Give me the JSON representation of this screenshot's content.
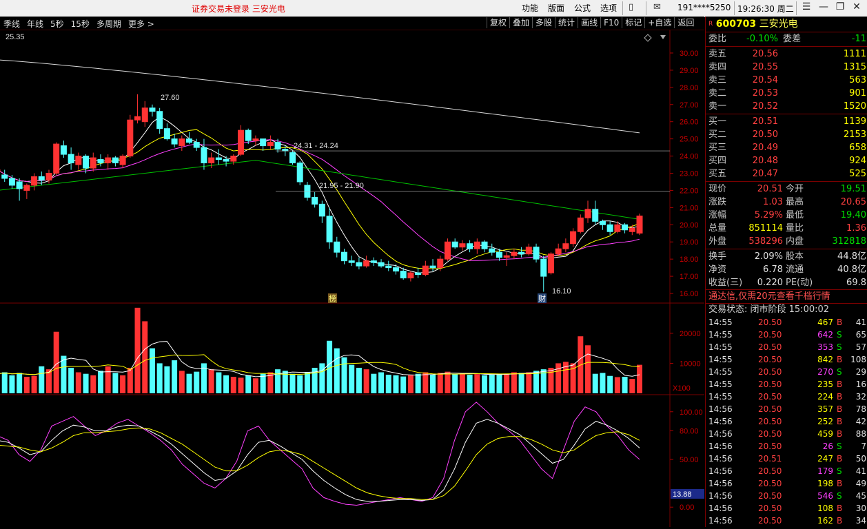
{
  "app": {
    "notice": "证券交易未登录   三安光电",
    "menu": [
      "功能",
      "版面",
      "公式",
      "选项"
    ],
    "user": "191****5250",
    "clock": "19:26:30 周二"
  },
  "tabs_left": [
    "季线",
    "年线",
    "5秒",
    "15秒",
    "多周期",
    "更多 >"
  ],
  "tabs_right": [
    "复权",
    "叠加",
    "多股",
    "统计",
    "画线",
    "F10",
    "标记",
    "+自选",
    "返回"
  ],
  "chart_labels": {
    "ma_readout": "25.35",
    "high_note": "27.60",
    "low_note": "16.10",
    "band_upper": "24.31 - 24.24",
    "band_lower": "21.95 - 21.90",
    "marker_left": "榜",
    "marker_right": "财",
    "vol_unit": "X100",
    "kdj_readout": "13.88"
  },
  "colors": {
    "up": "#ff3333",
    "down": "#54ffff",
    "ma5": "#ffffff",
    "ma10": "#ffff00",
    "ma20": "#ff40ff",
    "ma60": "#00c000"
  },
  "chart_data": [
    {
      "type": "candlestick",
      "title": "",
      "ylim": [
        15.6,
        30.6
      ],
      "yticks": [
        "30.00",
        "29.00",
        "28.00",
        "27.00",
        "26.00",
        "25.00",
        "24.00",
        "23.00",
        "22.00",
        "21.00",
        "20.00",
        "19.00",
        "18.00",
        "17.00",
        "16.00"
      ],
      "candles": [
        [
          23.1,
          23.3,
          22.8,
          23.2
        ],
        [
          22.9,
          23.2,
          22.5,
          22.7
        ],
        [
          22.7,
          22.9,
          22.1,
          22.3
        ],
        [
          22.5,
          22.7,
          21.4,
          22.1
        ],
        [
          22.0,
          22.4,
          21.5,
          22.3
        ],
        [
          22.3,
          23.0,
          22.0,
          22.8
        ],
        [
          22.8,
          23.1,
          22.3,
          22.6
        ],
        [
          22.6,
          23.2,
          22.4,
          23.0
        ],
        [
          23.0,
          24.8,
          22.9,
          24.7
        ],
        [
          24.6,
          24.9,
          23.9,
          24.1
        ],
        [
          24.1,
          24.5,
          23.2,
          23.6
        ],
        [
          23.5,
          24.2,
          23.2,
          24.0
        ],
        [
          24.0,
          24.1,
          23.0,
          23.3
        ],
        [
          23.3,
          24.2,
          23.1,
          23.9
        ],
        [
          23.8,
          24.1,
          23.4,
          23.6
        ],
        [
          23.6,
          24.1,
          23.2,
          23.9
        ],
        [
          23.9,
          24.0,
          23.4,
          23.6
        ],
        [
          23.5,
          24.1,
          23.3,
          24.0
        ],
        [
          24.0,
          26.4,
          23.9,
          26.1
        ],
        [
          26.1,
          27.6,
          25.9,
          26.3
        ],
        [
          26.0,
          27.2,
          25.7,
          26.8
        ],
        [
          26.8,
          27.0,
          26.3,
          26.6
        ],
        [
          26.6,
          26.8,
          25.3,
          25.6
        ],
        [
          25.6,
          25.9,
          24.9,
          25.0
        ],
        [
          25.0,
          25.3,
          24.5,
          24.7
        ],
        [
          24.6,
          25.2,
          24.3,
          25.0
        ],
        [
          25.0,
          25.4,
          24.7,
          24.8
        ],
        [
          24.8,
          25.0,
          24.3,
          24.5
        ],
        [
          24.5,
          25.0,
          23.2,
          23.6
        ],
        [
          23.6,
          24.2,
          23.3,
          23.9
        ],
        [
          23.9,
          24.4,
          23.5,
          23.8
        ],
        [
          23.8,
          24.0,
          23.4,
          23.7
        ],
        [
          23.7,
          24.1,
          23.5,
          24.0
        ],
        [
          24.1,
          25.8,
          24.0,
          25.5
        ],
        [
          25.5,
          25.6,
          24.7,
          24.9
        ],
        [
          24.9,
          25.2,
          24.6,
          25.0
        ],
        [
          25.0,
          25.0,
          24.3,
          24.6
        ],
        [
          24.6,
          25.2,
          24.4,
          24.8
        ],
        [
          24.8,
          25.0,
          24.2,
          24.4
        ],
        [
          24.4,
          24.6,
          24.0,
          24.3
        ],
        [
          24.2,
          24.3,
          23.5,
          23.6
        ],
        [
          23.6,
          23.7,
          22.3,
          22.5
        ],
        [
          22.3,
          22.5,
          21.4,
          21.6
        ],
        [
          21.6,
          21.9,
          21.0,
          21.2
        ],
        [
          21.2,
          21.4,
          20.1,
          20.5
        ],
        [
          20.5,
          21.0,
          18.6,
          19.0
        ],
        [
          19.0,
          19.3,
          18.1,
          18.4
        ],
        [
          18.4,
          18.6,
          17.7,
          17.9
        ],
        [
          17.9,
          18.2,
          17.6,
          17.8
        ],
        [
          17.8,
          18.1,
          17.4,
          17.6
        ],
        [
          17.6,
          18.2,
          17.5,
          17.9
        ],
        [
          17.9,
          18.1,
          17.6,
          17.8
        ],
        [
          17.8,
          18.0,
          17.5,
          17.6
        ],
        [
          17.6,
          17.9,
          17.3,
          17.5
        ],
        [
          17.5,
          17.7,
          17.1,
          17.3
        ],
        [
          17.3,
          17.5,
          16.8,
          16.9
        ],
        [
          16.9,
          17.3,
          16.7,
          17.2
        ],
        [
          17.2,
          17.5,
          16.9,
          17.1
        ],
        [
          17.1,
          17.9,
          17.0,
          17.6
        ],
        [
          17.6,
          18.0,
          17.3,
          17.5
        ],
        [
          17.5,
          18.2,
          17.3,
          18.0
        ],
        [
          18.0,
          19.2,
          17.9,
          19.0
        ],
        [
          19.0,
          19.2,
          18.6,
          18.7
        ],
        [
          18.7,
          19.1,
          18.5,
          18.9
        ],
        [
          18.9,
          19.1,
          18.4,
          18.6
        ],
        [
          18.6,
          19.2,
          18.3,
          19.0
        ],
        [
          19.0,
          19.1,
          18.4,
          18.6
        ],
        [
          18.6,
          18.9,
          18.2,
          18.4
        ],
        [
          18.4,
          18.6,
          17.9,
          18.1
        ],
        [
          18.1,
          18.4,
          17.6,
          18.2
        ],
        [
          18.2,
          18.6,
          18.0,
          18.4
        ],
        [
          18.4,
          18.7,
          18.1,
          18.3
        ],
        [
          18.3,
          18.9,
          18.2,
          18.7
        ],
        [
          18.7,
          18.9,
          17.8,
          18.0
        ],
        [
          18.0,
          18.2,
          16.1,
          17.0
        ],
        [
          17.2,
          18.4,
          17.1,
          18.3
        ],
        [
          18.3,
          18.9,
          18.2,
          18.6
        ],
        [
          18.6,
          19.2,
          18.4,
          18.9
        ],
        [
          18.9,
          19.8,
          18.7,
          19.6
        ],
        [
          19.6,
          20.6,
          19.5,
          20.4
        ],
        [
          20.4,
          21.4,
          20.1,
          20.9
        ],
        [
          20.9,
          21.4,
          20.0,
          20.2
        ],
        [
          20.2,
          20.3,
          19.7,
          20.0
        ],
        [
          20.0,
          20.2,
          19.4,
          19.6
        ],
        [
          19.6,
          20.2,
          19.5,
          20.0
        ],
        [
          20.0,
          20.1,
          19.5,
          19.7
        ],
        [
          19.6,
          20.0,
          19.4,
          19.8
        ],
        [
          19.51,
          20.65,
          19.4,
          20.51
        ]
      ],
      "ma_end": {
        "ma60_start": 29.6,
        "ma60_end": 25.35
      },
      "annotations": [
        {
          "text": "27.60",
          "at": "high"
        },
        {
          "text": "16.10",
          "at": "low"
        },
        {
          "text": "24.31 - 24.24",
          "at": "band-upper"
        },
        {
          "text": "21.95 - 21.90",
          "at": "band-lower"
        }
      ]
    },
    {
      "type": "bar",
      "title": "volume",
      "ylim": [
        0,
        28000
      ],
      "yticks": [
        "20000",
        "10000"
      ],
      "unit": "X100",
      "values": [
        6500,
        7000,
        6000,
        6800,
        5500,
        5800,
        9000,
        8000,
        20500,
        12500,
        8500,
        7000,
        6500,
        6000,
        7500,
        9000,
        6800,
        6000,
        8500,
        28500,
        24000,
        15000,
        10000,
        9000,
        11000,
        7500,
        6500,
        7200,
        10000,
        8000,
        7000,
        6000,
        5500,
        5200,
        6000,
        5000,
        6500,
        7000,
        8000,
        7500,
        6500,
        6000,
        7000,
        8500,
        10000,
        17500,
        15000,
        12000,
        9500,
        8500,
        8000,
        6500,
        7000,
        6200,
        6000,
        5600,
        6000,
        6500,
        7000,
        6200,
        6800,
        7200,
        6500,
        6600,
        6200,
        6400,
        6000,
        6200,
        6500,
        6500,
        7000,
        6800,
        7000,
        7500,
        8000,
        8500,
        10000,
        10500,
        10000,
        19000,
        16000,
        6500,
        6800,
        5800,
        5400,
        5500,
        4800,
        9500
      ],
      "ma_lines": 2
    },
    {
      "type": "line",
      "title": "KDJ",
      "ylim": [
        -15,
        115
      ],
      "yticks": [
        "100.00",
        "80.00",
        "50.00",
        "13.88",
        "0.00"
      ],
      "series": [
        {
          "color": "#ff40ff",
          "values": [
            75,
            70,
            55,
            48,
            60,
            85,
            90,
            95,
            85,
            75,
            80,
            88,
            92,
            85,
            78,
            70,
            60,
            45,
            35,
            25,
            20,
            30,
            48,
            80,
            85,
            70,
            60,
            50,
            40,
            20,
            10,
            6,
            3,
            2,
            4,
            6,
            8,
            10,
            8,
            6,
            10,
            30,
            70,
            100,
            110,
            100,
            88,
            80,
            70,
            55,
            40,
            30,
            60,
            90,
            105,
            100,
            85,
            75,
            60,
            50
          ]
        },
        {
          "color": "#ffffff",
          "values": [
            70,
            68,
            62,
            55,
            58,
            70,
            80,
            86,
            84,
            80,
            80,
            84,
            86,
            85,
            80,
            74,
            66,
            56,
            46,
            36,
            28,
            30,
            38,
            55,
            68,
            70,
            64,
            57,
            50,
            38,
            28,
            20,
            13,
            8,
            6,
            6,
            7,
            8,
            8,
            7,
            8,
            18,
            40,
            68,
            88,
            92,
            88,
            82,
            76,
            66,
            56,
            46,
            50,
            65,
            82,
            90,
            86,
            80,
            72,
            62
          ]
        },
        {
          "color": "#ffff00",
          "values": [
            65,
            64,
            63,
            60,
            58,
            62,
            68,
            75,
            78,
            78,
            79,
            80,
            82,
            83,
            82,
            78,
            72,
            66,
            58,
            50,
            42,
            38,
            38,
            44,
            52,
            58,
            60,
            58,
            55,
            48,
            41,
            34,
            27,
            20,
            15,
            12,
            10,
            9,
            9,
            8,
            8,
            12,
            22,
            38,
            55,
            66,
            72,
            74,
            74,
            71,
            66,
            60,
            57,
            60,
            68,
            75,
            78,
            79,
            76,
            70
          ]
        }
      ]
    }
  ],
  "panel": {
    "code": "600703",
    "name": "三安光电",
    "weibi": {
      "label": "委比",
      "value": "-0.10%",
      "label2": "委差",
      "value2": "-11"
    },
    "asks": [
      {
        "label": "卖五",
        "price": "20.56",
        "vol": "1111"
      },
      {
        "label": "卖四",
        "price": "20.55",
        "vol": "1315"
      },
      {
        "label": "卖三",
        "price": "20.54",
        "vol": "563"
      },
      {
        "label": "卖二",
        "price": "20.53",
        "vol": "901"
      },
      {
        "label": "卖一",
        "price": "20.52",
        "vol": "1520"
      }
    ],
    "bids": [
      {
        "label": "买一",
        "price": "20.51",
        "vol": "1139"
      },
      {
        "label": "买二",
        "price": "20.50",
        "vol": "2153"
      },
      {
        "label": "买三",
        "price": "20.49",
        "vol": "658"
      },
      {
        "label": "买四",
        "price": "20.48",
        "vol": "924"
      },
      {
        "label": "买五",
        "price": "20.47",
        "vol": "525"
      }
    ],
    "quote": [
      {
        "l1": "现价",
        "v1": "20.51",
        "c1": "red",
        "l2": "今开",
        "v2": "19.51",
        "c2": "green"
      },
      {
        "l1": "涨跌",
        "v1": "1.03",
        "c1": "red",
        "l2": "最高",
        "v2": "20.65",
        "c2": "red"
      },
      {
        "l1": "涨幅",
        "v1": "5.29%",
        "c1": "red",
        "l2": "最低",
        "v2": "19.40",
        "c2": "green"
      },
      {
        "l1": "总量",
        "v1": "851114",
        "c1": "yellow",
        "l2": "量比",
        "v2": "1.36",
        "c2": "red"
      },
      {
        "l1": "外盘",
        "v1": "538296",
        "c1": "red",
        "l2": "内盘",
        "v2": "312818",
        "c2": "green"
      }
    ],
    "quote2": [
      {
        "l1": "换手",
        "v1": "2.09%",
        "c1": "white",
        "l2": "股本",
        "v2": "44.8亿",
        "c2": "white"
      },
      {
        "l1": "净资",
        "v1": "6.78",
        "c1": "white",
        "l2": "流通",
        "v2": "40.8亿",
        "c2": "white"
      },
      {
        "l1": "收益(三)",
        "v1": "0.220",
        "c1": "white",
        "l2": "PE(动)",
        "v2": "69.8",
        "c2": "white"
      }
    ],
    "ad": "通达信,仅需20元查看千档行情",
    "state": "交易状态: 闭市阶段 15:00:02",
    "ticks": [
      [
        "14:55",
        "20.50",
        "467",
        "B",
        "41"
      ],
      [
        "14:55",
        "20.50",
        "642",
        "S",
        "65"
      ],
      [
        "14:55",
        "20.50",
        "353",
        "S",
        "57"
      ],
      [
        "14:55",
        "20.50",
        "842",
        "B",
        "108"
      ],
      [
        "14:55",
        "20.50",
        "270",
        "S",
        "29"
      ],
      [
        "14:55",
        "20.50",
        "235",
        "B",
        "16"
      ],
      [
        "14:55",
        "20.50",
        "224",
        "B",
        "32"
      ],
      [
        "14:56",
        "20.50",
        "357",
        "B",
        "78"
      ],
      [
        "14:56",
        "20.50",
        "252",
        "B",
        "42"
      ],
      [
        "14:56",
        "20.50",
        "459",
        "B",
        "88"
      ],
      [
        "14:56",
        "20.50",
        "26",
        "S",
        "7"
      ],
      [
        "14:56",
        "20.51",
        "247",
        "B",
        "50"
      ],
      [
        "14:56",
        "20.50",
        "179",
        "S",
        "41"
      ],
      [
        "14:56",
        "20.50",
        "198",
        "B",
        "49"
      ],
      [
        "14:56",
        "20.50",
        "546",
        "S",
        "45"
      ],
      [
        "14:56",
        "20.50",
        "108",
        "B",
        "30"
      ],
      [
        "14:56",
        "20.50",
        "162",
        "B",
        "34"
      ]
    ]
  }
}
